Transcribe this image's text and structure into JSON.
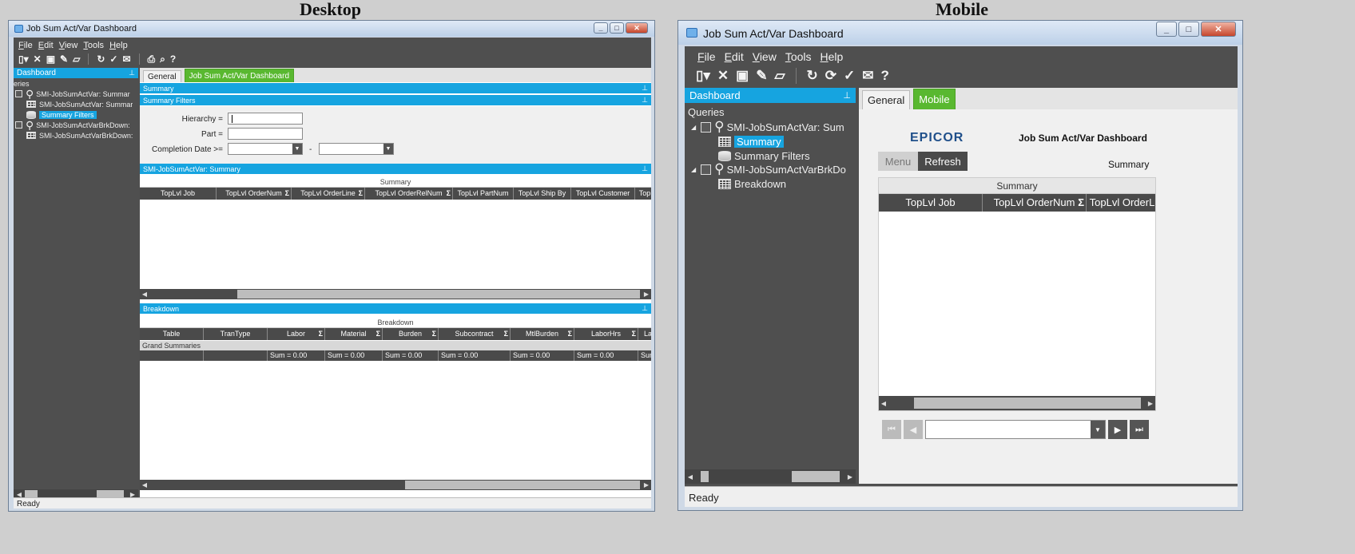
{
  "headers": {
    "desktop": "Desktop",
    "mobile": "Mobile"
  },
  "window": {
    "title": "Job Sum Act/Var Dashboard",
    "menu": [
      "File",
      "Edit",
      "View",
      "Tools",
      "Help"
    ],
    "status": "Ready"
  },
  "tree": {
    "pane_title": "Dashboard",
    "desktop_root_label": "eries",
    "mobile_root_label": "Queries",
    "desktop_items": [
      {
        "label": "SMI-JobSumActVar: Summar",
        "icon": "satellite-icon"
      },
      {
        "label": "SMI-JobSumActVar: Summar",
        "icon": "grid-icon"
      },
      {
        "label": "Summary Filters",
        "icon": "database-icon",
        "selected": true
      },
      {
        "label": "SMI-JobSumActVarBrkDown:",
        "icon": "satellite-icon"
      },
      {
        "label": "SMI-JobSumActVarBrkDown:",
        "icon": "grid-icon"
      }
    ],
    "mobile_items": [
      {
        "label": "SMI-JobSumActVar: Sum",
        "icon": "satellite-icon"
      },
      {
        "label": "Summary",
        "icon": "grid-icon",
        "selected": true
      },
      {
        "label": "Summary Filters",
        "icon": "database-icon"
      },
      {
        "label": "SMI-JobSumActVarBrkDo",
        "icon": "satellite-icon"
      },
      {
        "label": "Breakdown",
        "icon": "grid-icon"
      }
    ]
  },
  "desktop": {
    "tabs": [
      "General",
      "Job Sum Act/Var Dashboard"
    ],
    "sections": {
      "summary": "Summary",
      "summary_filters": "Summary Filters",
      "grid1": "SMI-JobSumActVar: Summary",
      "breakdown": "Breakdown"
    },
    "filters": {
      "hierarchy_label": "Hierarchy =",
      "part_label": "Part =",
      "completion_label": "Completion Date >=",
      "range_sep": "-"
    },
    "summary_grid": {
      "caption": "Summary",
      "columns": [
        {
          "label": "TopLvl Job",
          "sigma": false
        },
        {
          "label": "TopLvl OrderNum",
          "sigma": true
        },
        {
          "label": "TopLvl OrderLine",
          "sigma": true
        },
        {
          "label": "TopLvl OrderRelNum",
          "sigma": true
        },
        {
          "label": "TopLvl PartNum",
          "sigma": false
        },
        {
          "label": "TopLvl Ship By",
          "sigma": false
        },
        {
          "label": "TopLvl Customer",
          "sigma": false
        },
        {
          "label": "TopL",
          "sigma": false
        }
      ]
    },
    "breakdown_grid": {
      "caption": "Breakdown",
      "columns": [
        {
          "label": "Table",
          "sigma": false
        },
        {
          "label": "TranType",
          "sigma": false
        },
        {
          "label": "Labor",
          "sigma": true
        },
        {
          "label": "Material",
          "sigma": true
        },
        {
          "label": "Burden",
          "sigma": true
        },
        {
          "label": "Subcontract",
          "sigma": true
        },
        {
          "label": "MtlBurden",
          "sigma": true
        },
        {
          "label": "LaborHrs",
          "sigma": true
        },
        {
          "label": "Lab",
          "sigma": false
        }
      ],
      "grand_label": "Grand Summaries",
      "sums": [
        "",
        "",
        "Sum = 0.00",
        "Sum = 0.00",
        "Sum = 0.00",
        "Sum = 0.00",
        "Sum = 0.00",
        "Sum = 0.00",
        "Sum ="
      ]
    }
  },
  "mobile": {
    "tabs": [
      "General",
      "Mobile"
    ],
    "logo": "EPICOR",
    "dash_title": "Job Sum Act/Var Dashboard",
    "menu_button": "Menu",
    "refresh_button": "Refresh",
    "current_view": "Summary",
    "grid": {
      "caption": "Summary",
      "columns": [
        {
          "label": "TopLvl Job",
          "sigma": false
        },
        {
          "label": "TopLvl OrderNum",
          "sigma": true
        },
        {
          "label": "TopLvl OrderL",
          "sigma": false
        }
      ]
    }
  },
  "colors": {
    "accent": "#16a4e0",
    "tab_active": "#59b830",
    "panel": "#4f4f4f"
  }
}
